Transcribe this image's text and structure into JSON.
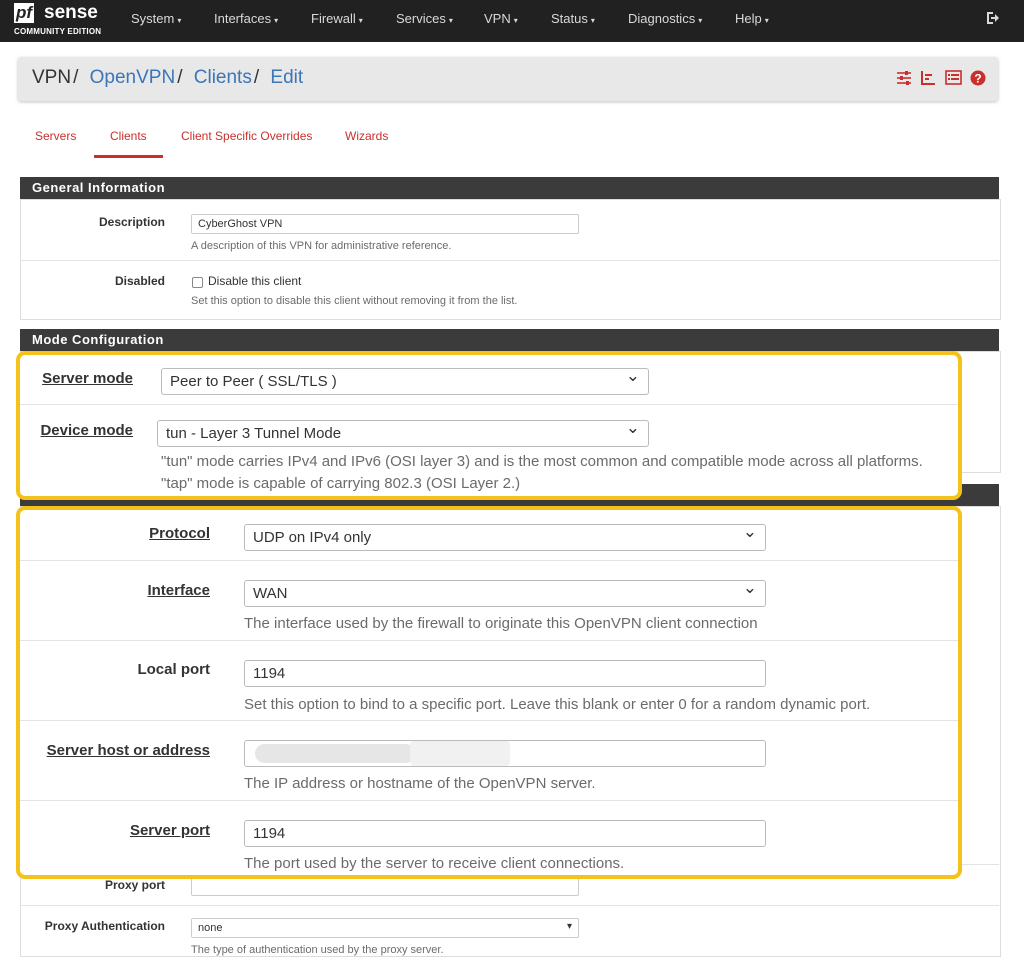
{
  "brand": {
    "logo_pf": "pf",
    "logo_sense": "sense",
    "edition": "COMMUNITY EDITION"
  },
  "nav": {
    "items": [
      {
        "label": "System"
      },
      {
        "label": "Interfaces"
      },
      {
        "label": "Firewall"
      },
      {
        "label": "Services"
      },
      {
        "label": "VPN"
      },
      {
        "label": "Status"
      },
      {
        "label": "Diagnostics"
      },
      {
        "label": "Help"
      }
    ],
    "caret": "▾",
    "logout_icon": "logout-icon"
  },
  "breadcrumb": {
    "vpn": "VPN",
    "openvpn": "OpenVPN",
    "clients": "Clients",
    "edit": "Edit",
    "sep": "/"
  },
  "toolbar_icons": [
    "sliders-icon",
    "bar-chart-icon",
    "list-icon",
    "help-icon"
  ],
  "tabs": [
    {
      "label": "Servers",
      "active": false
    },
    {
      "label": "Clients",
      "active": true
    },
    {
      "label": "Client Specific Overrides",
      "active": false
    },
    {
      "label": "Wizards",
      "active": false
    }
  ],
  "general": {
    "heading": "General Information",
    "description_label": "Description",
    "description_value": "CyberGhost VPN",
    "description_help": "A description of this VPN for administrative reference.",
    "disabled_label": "Disabled",
    "disabled_checkbox_text": "Disable this client",
    "disabled_help": "Set this option to disable this client without removing it from the list."
  },
  "mode": {
    "heading": "Mode Configuration",
    "server_mode_label": "Server mode",
    "server_mode_value": "Peer to Peer ( SSL/TLS )",
    "device_mode_label": "Device mode",
    "device_mode_value": "tun - Layer 3 Tunnel Mode",
    "device_help_1": "\"tun\" mode carries IPv4 and IPv6 (OSI layer 3) and is the most common and compatible mode across all platforms.",
    "device_help_2": "\"tap\" mode is capable of carrying 802.3 (OSI Layer 2.)"
  },
  "endpoint": {
    "protocol_label": "Protocol",
    "protocol_value": "UDP on IPv4 only",
    "interface_label": "Interface",
    "interface_value": "WAN",
    "interface_help": "The interface used by the firewall to originate this OpenVPN client connection",
    "local_port_label": "Local port",
    "local_port_value": "1194",
    "local_port_help": "Set this option to bind to a specific port. Leave this blank or enter 0 for a random dynamic port.",
    "server_host_label": "Server host or address",
    "server_host_help": "The IP address or hostname of the OpenVPN server.",
    "server_port_label": "Server port",
    "server_port_value": "1194",
    "server_port_help": "The port used by the server to receive client connections."
  },
  "proxy": {
    "proxy_port_label": "Proxy port",
    "proxy_auth_label": "Proxy Authentication",
    "proxy_auth_value": "none",
    "proxy_auth_help": "The type of authentication used by the proxy server."
  },
  "colors": {
    "accent": "#c9302c",
    "link": "#3a76b8",
    "navbar": "#212121",
    "panel_head": "#3b3b3b",
    "callout": "#f5c21b"
  }
}
